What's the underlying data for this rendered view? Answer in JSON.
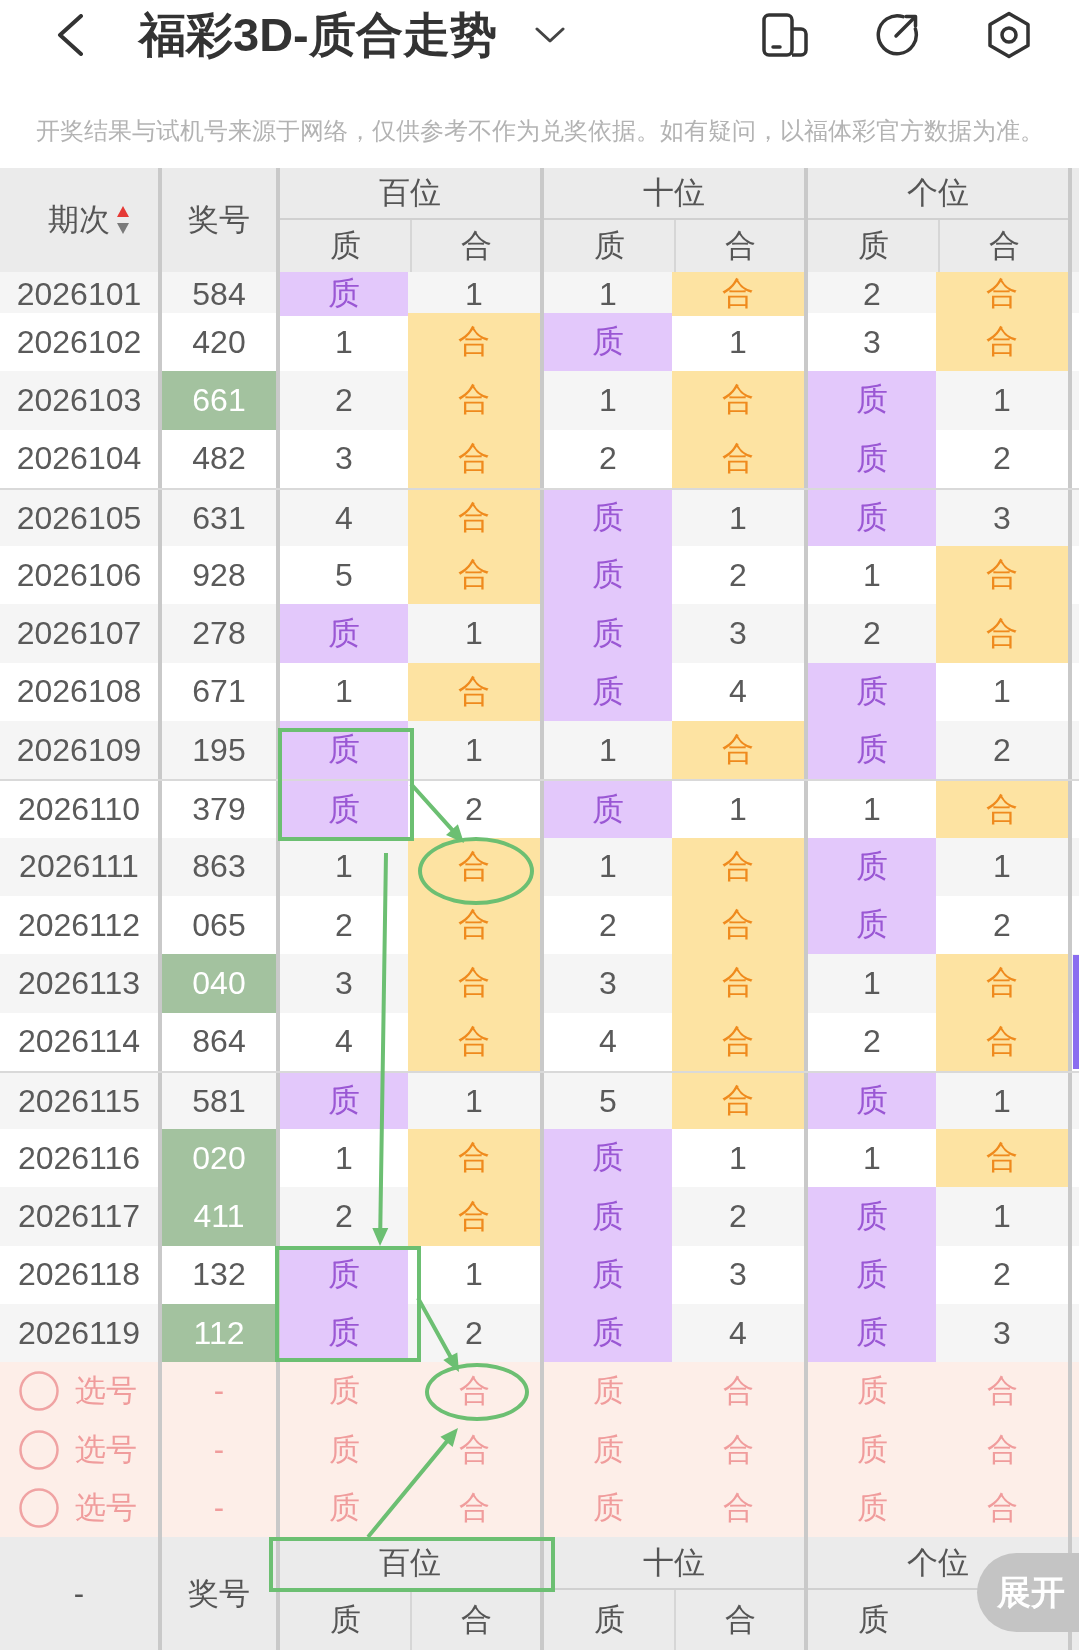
{
  "top_bar": {
    "title": "福彩3D-质合走势"
  },
  "notice": "开奖结果与试机号来源于网络，仅供参考不作为兑奖依据。如有疑问，以福体彩官方数据为准。",
  "table": {
    "header": {
      "columns": [
        {
          "label": "期次",
          "sorted_ascending": true
        },
        {
          "label": "奖号"
        }
      ],
      "groups": [
        {
          "label": "百位",
          "sub": [
            {
              "label": "质",
              "kind": "prime"
            },
            {
              "label": "合",
              "kind": "composite"
            }
          ]
        },
        {
          "label": "十位",
          "sub": [
            {
              "label": "质",
              "kind": "prime"
            },
            {
              "label": "合",
              "kind": "composite"
            }
          ]
        },
        {
          "label": "个位",
          "sub": [
            {
              "label": "质",
              "kind": "prime"
            },
            {
              "label": "合",
              "kind": "composite"
            }
          ]
        }
      ]
    },
    "rows": [
      {
        "period": "2026101",
        "number": "584",
        "highlight": false,
        "cells": [
          {
            "text": "质",
            "hit": true
          },
          {
            "text": "1",
            "hit": false
          },
          {
            "text": "1",
            "hit": false
          },
          {
            "text": "合",
            "hit": true
          },
          {
            "text": "2",
            "hit": false
          },
          {
            "text": "合",
            "hit": true
          }
        ]
      },
      {
        "period": "2026102",
        "number": "420",
        "highlight": false,
        "cells": [
          {
            "text": "1",
            "hit": false
          },
          {
            "text": "合",
            "hit": true
          },
          {
            "text": "质",
            "hit": true
          },
          {
            "text": "1",
            "hit": false
          },
          {
            "text": "3",
            "hit": false
          },
          {
            "text": "合",
            "hit": true
          }
        ]
      },
      {
        "period": "2026103",
        "number": "661",
        "highlight": true,
        "cells": [
          {
            "text": "2",
            "hit": false
          },
          {
            "text": "合",
            "hit": true
          },
          {
            "text": "1",
            "hit": false
          },
          {
            "text": "合",
            "hit": true
          },
          {
            "text": "质",
            "hit": true
          },
          {
            "text": "1",
            "hit": false
          }
        ]
      },
      {
        "period": "2026104",
        "number": "482",
        "highlight": false,
        "cells": [
          {
            "text": "3",
            "hit": false
          },
          {
            "text": "合",
            "hit": true
          },
          {
            "text": "2",
            "hit": false
          },
          {
            "text": "合",
            "hit": true
          },
          {
            "text": "质",
            "hit": true
          },
          {
            "text": "2",
            "hit": false
          }
        ]
      },
      {
        "period": "2026105",
        "number": "631",
        "highlight": false,
        "cells": [
          {
            "text": "4",
            "hit": false
          },
          {
            "text": "合",
            "hit": true
          },
          {
            "text": "质",
            "hit": true
          },
          {
            "text": "1",
            "hit": false
          },
          {
            "text": "质",
            "hit": true
          },
          {
            "text": "3",
            "hit": false
          }
        ]
      },
      {
        "period": "2026106",
        "number": "928",
        "highlight": false,
        "cells": [
          {
            "text": "5",
            "hit": false
          },
          {
            "text": "合",
            "hit": true
          },
          {
            "text": "质",
            "hit": true
          },
          {
            "text": "2",
            "hit": false
          },
          {
            "text": "1",
            "hit": false
          },
          {
            "text": "合",
            "hit": true
          }
        ]
      },
      {
        "period": "2026107",
        "number": "278",
        "highlight": false,
        "cells": [
          {
            "text": "质",
            "hit": true
          },
          {
            "text": "1",
            "hit": false
          },
          {
            "text": "质",
            "hit": true
          },
          {
            "text": "3",
            "hit": false
          },
          {
            "text": "2",
            "hit": false
          },
          {
            "text": "合",
            "hit": true
          }
        ]
      },
      {
        "period": "2026108",
        "number": "671",
        "highlight": false,
        "cells": [
          {
            "text": "1",
            "hit": false
          },
          {
            "text": "合",
            "hit": true
          },
          {
            "text": "质",
            "hit": true
          },
          {
            "text": "4",
            "hit": false
          },
          {
            "text": "质",
            "hit": true
          },
          {
            "text": "1",
            "hit": false
          }
        ]
      },
      {
        "period": "2026109",
        "number": "195",
        "highlight": false,
        "cells": [
          {
            "text": "质",
            "hit": true
          },
          {
            "text": "1",
            "hit": false
          },
          {
            "text": "1",
            "hit": false
          },
          {
            "text": "合",
            "hit": true
          },
          {
            "text": "质",
            "hit": true
          },
          {
            "text": "2",
            "hit": false
          }
        ]
      },
      {
        "period": "2026110",
        "number": "379",
        "highlight": false,
        "cells": [
          {
            "text": "质",
            "hit": true
          },
          {
            "text": "2",
            "hit": false
          },
          {
            "text": "质",
            "hit": true
          },
          {
            "text": "1",
            "hit": false
          },
          {
            "text": "1",
            "hit": false
          },
          {
            "text": "合",
            "hit": true
          }
        ]
      },
      {
        "period": "2026111",
        "number": "863",
        "highlight": false,
        "cells": [
          {
            "text": "1",
            "hit": false
          },
          {
            "text": "合",
            "hit": true
          },
          {
            "text": "1",
            "hit": false
          },
          {
            "text": "合",
            "hit": true
          },
          {
            "text": "质",
            "hit": true
          },
          {
            "text": "1",
            "hit": false
          }
        ]
      },
      {
        "period": "2026112",
        "number": "065",
        "highlight": false,
        "cells": [
          {
            "text": "2",
            "hit": false
          },
          {
            "text": "合",
            "hit": true
          },
          {
            "text": "2",
            "hit": false
          },
          {
            "text": "合",
            "hit": true
          },
          {
            "text": "质",
            "hit": true
          },
          {
            "text": "2",
            "hit": false
          }
        ]
      },
      {
        "period": "2026113",
        "number": "040",
        "highlight": true,
        "cells": [
          {
            "text": "3",
            "hit": false
          },
          {
            "text": "合",
            "hit": true
          },
          {
            "text": "3",
            "hit": false
          },
          {
            "text": "合",
            "hit": true
          },
          {
            "text": "1",
            "hit": false
          },
          {
            "text": "合",
            "hit": true
          }
        ]
      },
      {
        "period": "2026114",
        "number": "864",
        "highlight": false,
        "cells": [
          {
            "text": "4",
            "hit": false
          },
          {
            "text": "合",
            "hit": true
          },
          {
            "text": "4",
            "hit": false
          },
          {
            "text": "合",
            "hit": true
          },
          {
            "text": "2",
            "hit": false
          },
          {
            "text": "合",
            "hit": true
          }
        ]
      },
      {
        "period": "2026115",
        "number": "581",
        "highlight": false,
        "cells": [
          {
            "text": "质",
            "hit": true
          },
          {
            "text": "1",
            "hit": false
          },
          {
            "text": "5",
            "hit": false
          },
          {
            "text": "合",
            "hit": true
          },
          {
            "text": "质",
            "hit": true
          },
          {
            "text": "1",
            "hit": false
          }
        ]
      },
      {
        "period": "2026116",
        "number": "020",
        "highlight": true,
        "cells": [
          {
            "text": "1",
            "hit": false
          },
          {
            "text": "合",
            "hit": true
          },
          {
            "text": "质",
            "hit": true
          },
          {
            "text": "1",
            "hit": false
          },
          {
            "text": "1",
            "hit": false
          },
          {
            "text": "合",
            "hit": true
          }
        ]
      },
      {
        "period": "2026117",
        "number": "411",
        "highlight": true,
        "cells": [
          {
            "text": "2",
            "hit": false
          },
          {
            "text": "合",
            "hit": true
          },
          {
            "text": "质",
            "hit": true
          },
          {
            "text": "2",
            "hit": false
          },
          {
            "text": "质",
            "hit": true
          },
          {
            "text": "1",
            "hit": false
          }
        ]
      },
      {
        "period": "2026118",
        "number": "132",
        "highlight": false,
        "cells": [
          {
            "text": "质",
            "hit": true
          },
          {
            "text": "1",
            "hit": false
          },
          {
            "text": "质",
            "hit": true
          },
          {
            "text": "3",
            "hit": false
          },
          {
            "text": "质",
            "hit": true
          },
          {
            "text": "2",
            "hit": false
          }
        ]
      },
      {
        "period": "2026119",
        "number": "112",
        "highlight": true,
        "cells": [
          {
            "text": "质",
            "hit": true
          },
          {
            "text": "2",
            "hit": false
          },
          {
            "text": "质",
            "hit": true
          },
          {
            "text": "4",
            "hit": false
          },
          {
            "text": "质",
            "hit": true
          },
          {
            "text": "3",
            "hit": false
          }
        ]
      }
    ],
    "picker_rows": [
      {
        "label": "选号",
        "checked": false,
        "number": "-",
        "options": [
          {
            "text": "质",
            "selected": false
          },
          {
            "text": "合",
            "selected": false
          },
          {
            "text": "质",
            "selected": false
          },
          {
            "text": "合",
            "selected": false
          },
          {
            "text": "质",
            "selected": false
          },
          {
            "text": "合",
            "selected": false
          }
        ]
      },
      {
        "label": "选号",
        "checked": false,
        "number": "-",
        "options": [
          {
            "text": "质",
            "selected": false
          },
          {
            "text": "合",
            "selected": false
          },
          {
            "text": "质",
            "selected": false
          },
          {
            "text": "合",
            "selected": false
          },
          {
            "text": "质",
            "selected": false
          },
          {
            "text": "合",
            "selected": false
          }
        ]
      },
      {
        "label": "选号",
        "checked": false,
        "number": "-",
        "options": [
          {
            "text": "质",
            "selected": false
          },
          {
            "text": "合",
            "selected": false
          },
          {
            "text": "质",
            "selected": false
          },
          {
            "text": "合",
            "selected": false
          },
          {
            "text": "质",
            "selected": false
          },
          {
            "text": "合",
            "selected": false
          }
        ]
      }
    ],
    "footer": {
      "columns": [
        {
          "label": "-"
        },
        {
          "label": "奖号"
        }
      ],
      "groups": [
        {
          "label": "百位",
          "sub": [
            {
              "label": "质"
            },
            {
              "label": "合"
            }
          ]
        },
        {
          "label": "十位",
          "sub": [
            {
              "label": "质"
            },
            {
              "label": "合"
            }
          ]
        },
        {
          "label": "个位",
          "sub": [
            {
              "label": "质"
            }
          ]
        }
      ]
    }
  },
  "expand_button": {
    "label": "展开"
  }
}
